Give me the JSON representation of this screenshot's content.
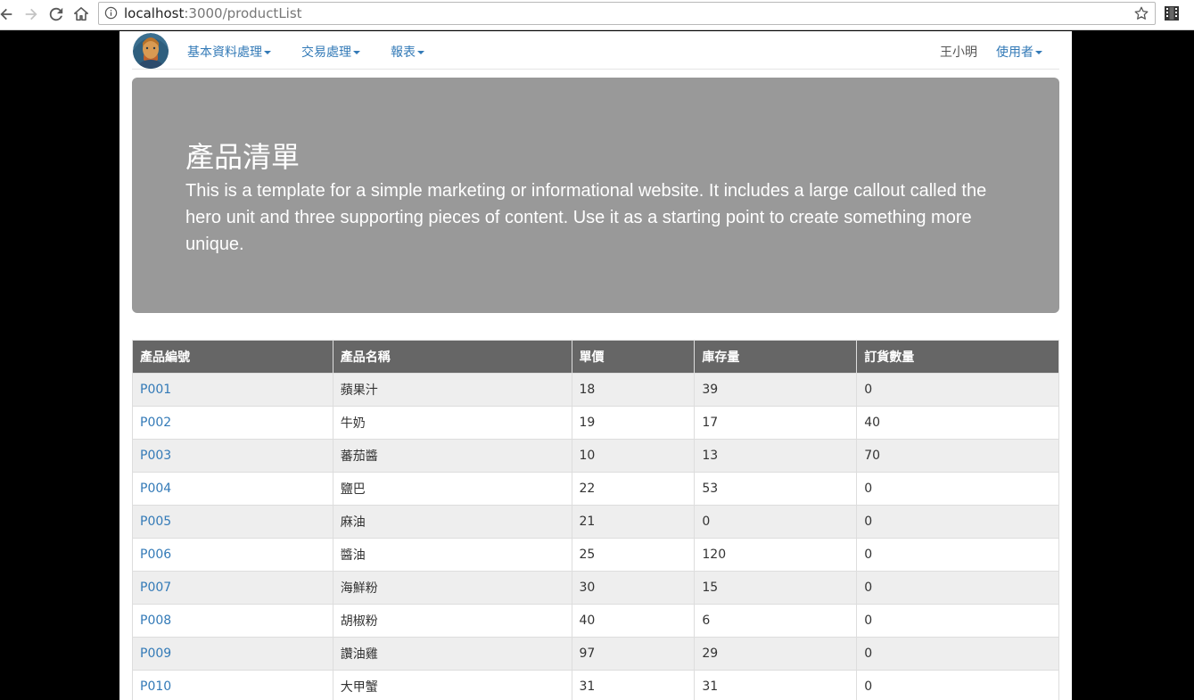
{
  "browser": {
    "url_host": "localhost",
    "url_path": ":3000/productList"
  },
  "navbar": {
    "menus": [
      {
        "label": "基本資料處理"
      },
      {
        "label": "交易處理"
      },
      {
        "label": "報表"
      }
    ],
    "username": "王小明",
    "user_menu_label": "使用者"
  },
  "jumbotron": {
    "title": "產品清單",
    "text": "This is a template for a simple marketing or informational website. It includes a large callout called the hero unit and three supporting pieces of content. Use it as a starting point to create something more unique."
  },
  "table": {
    "headers": [
      "產品編號",
      "產品名稱",
      "單價",
      "庫存量",
      "訂貨數量"
    ],
    "rows": [
      [
        "P001",
        "蘋果汁",
        "18",
        "39",
        "0"
      ],
      [
        "P002",
        "牛奶",
        "19",
        "17",
        "40"
      ],
      [
        "P003",
        "蕃茄醬",
        "10",
        "13",
        "70"
      ],
      [
        "P004",
        "鹽巴",
        "22",
        "53",
        "0"
      ],
      [
        "P005",
        "麻油",
        "21",
        "0",
        "0"
      ],
      [
        "P006",
        "醬油",
        "25",
        "120",
        "0"
      ],
      [
        "P007",
        "海鮮粉",
        "30",
        "15",
        "0"
      ],
      [
        "P008",
        "胡椒粉",
        "40",
        "6",
        "0"
      ],
      [
        "P009",
        "讚油雞",
        "97",
        "29",
        "0"
      ],
      [
        "P010",
        "大甲蟹",
        "31",
        "31",
        "0"
      ]
    ]
  },
  "colors": {
    "link": "#337ab7",
    "jumbotron_bg": "#999999",
    "table_header_bg": "#666666",
    "striped_row_bg": "#eeeeee"
  }
}
